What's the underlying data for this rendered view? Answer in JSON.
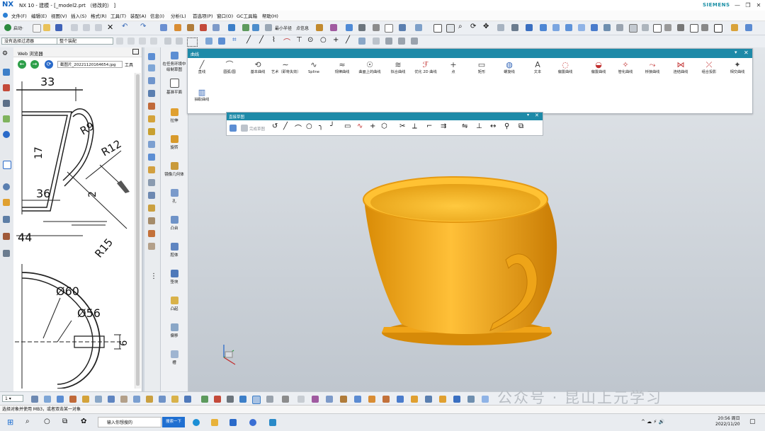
{
  "window": {
    "logo": "NX",
    "title": "NX 10 - 建模 - [_model2.prt （修改的） ]",
    "brand": "SIEMENS",
    "min": "—",
    "restore": "❐",
    "close": "✕"
  },
  "menu": [
    "文件(F)",
    "编辑(E)",
    "视图(V)",
    "插入(S)",
    "格式(R)",
    "工具(T)",
    "装配(A)",
    "信息(I)",
    "分析(L)",
    "首选项(P)",
    "窗口(O)",
    "GC工具箱",
    "帮助(H)"
  ],
  "toolbar1": {
    "start": "启动·",
    "dist": "最小半径",
    "info": "点信息"
  },
  "toolbar2": {
    "filter": "没有选择过滤器",
    "scope": "整个装配"
  },
  "web_panel": {
    "title": "Web 浏览器",
    "url": "截图片_20221120164654.jpg",
    "tool_label": "工具",
    "back": "←",
    "forward": "→",
    "refresh": "⟳",
    "drawing_dims": {
      "d33": "33",
      "d17": "17",
      "r9": "R9",
      "r12": "R12",
      "d36": "36",
      "d2": "2",
      "d44": "44",
      "r15": "R15",
      "phi60": "Ø60",
      "phi56": "Ø56",
      "d6": "6"
    }
  },
  "feature_panel": {
    "items": [
      "在任务环境中绘制草图",
      "基准平面",
      "拉伸",
      "旋转",
      "镜像几何体",
      "孔",
      "凸台",
      "腔体",
      "垫块",
      "凸起",
      "偏移",
      "槽"
    ]
  },
  "curve_panel": {
    "title": "曲线",
    "close": "✕",
    "items": [
      {
        "label": "直线",
        "glyph": "╱"
      },
      {
        "label": "圆弧/圆",
        "glyph": "⌒"
      },
      {
        "label": "基本曲线",
        "glyph": "⟲"
      },
      {
        "label": "艺术（即将失效）",
        "glyph": "∼"
      },
      {
        "label": "Spline",
        "glyph": "∿"
      },
      {
        "label": "规律曲线",
        "glyph": "≈"
      },
      {
        "label": "曲面上的曲线",
        "glyph": "☉"
      },
      {
        "label": "拟合曲线",
        "glyph": "≋"
      },
      {
        "label": "优化 2D 曲线",
        "glyph": "ℱ"
      },
      {
        "label": "点",
        "glyph": "+"
      },
      {
        "label": "矩形",
        "glyph": "▭"
      },
      {
        "label": "螺旋线",
        "glyph": "◍"
      },
      {
        "label": "文本",
        "glyph": "A"
      },
      {
        "label": "偏置曲线",
        "glyph": "◌"
      },
      {
        "label": "偏置曲线",
        "glyph": "◒"
      },
      {
        "label": "管化曲线",
        "glyph": "✧"
      },
      {
        "label": "桥接曲线",
        "glyph": "⤳"
      },
      {
        "label": "连结曲线",
        "glyph": "⋈"
      },
      {
        "label": "组合投影",
        "glyph": "⤫"
      },
      {
        "label": "相交曲线",
        "glyph": "✦"
      },
      {
        "label": "抽取曲线",
        "glyph": "▥"
      }
    ]
  },
  "sketch_panel": {
    "title": "直接草图",
    "label": "完成草图"
  },
  "status": {
    "text": "选择对象并使用 MB3，或者双击某一对象"
  },
  "taskbar": {
    "search_placeholder": "输入你想搜的",
    "search_btn": "搜索一下",
    "time": "20:56 周日",
    "date": "2022/11/20"
  },
  "watermark": "公众号 · 昆山上元学习",
  "colors": {
    "cup": "#f2a514",
    "panel_header": "#1e8aa8",
    "brand": "#1a8fa5"
  }
}
